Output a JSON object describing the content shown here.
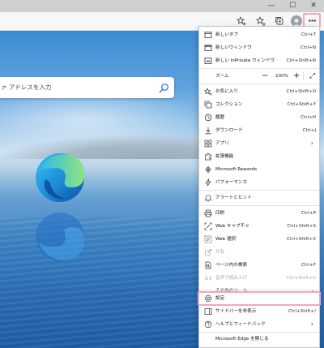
{
  "window": {
    "minimize": "—",
    "maximize": "☐",
    "close": "✕"
  },
  "toolbar": {
    "more": "···"
  },
  "search": {
    "placeholder": "ァ アドレスを入力"
  },
  "menu": {
    "items": [
      {
        "label": "新しいタブ",
        "shortcut": "Ctrl+T",
        "icon": "new-tab-icon"
      },
      {
        "label": "新しいウィンドウ",
        "shortcut": "Ctrl+N",
        "icon": "new-window-icon"
      },
      {
        "label": "新しい InPrivate ウィンドウ",
        "shortcut": "Ctrl+Shift+N",
        "icon": "inprivate-icon"
      },
      {
        "label": "ズーム",
        "icon": "none"
      },
      {
        "label": "お気に入り",
        "shortcut": "Ctrl+Shift+O",
        "icon": "favorites-icon"
      },
      {
        "label": "コレクション",
        "shortcut": "Ctrl+Shift+Y",
        "icon": "collections-icon"
      },
      {
        "label": "履歴",
        "shortcut": "Ctrl+H",
        "icon": "history-icon"
      },
      {
        "label": "ダウンロード",
        "shortcut": "Ctrl+J",
        "icon": "download-icon"
      },
      {
        "label": "アプリ",
        "icon": "apps-icon"
      },
      {
        "label": "拡張機能",
        "icon": "extensions-icon"
      },
      {
        "label": "Microsoft Rewards",
        "icon": "rewards-icon"
      },
      {
        "label": "パフォーマンス",
        "icon": "performance-icon"
      },
      {
        "label": "アラートとヒント",
        "icon": "bell-icon"
      },
      {
        "label": "印刷",
        "shortcut": "Ctrl+P",
        "icon": "print-icon"
      },
      {
        "label": "Web キャプチャ",
        "shortcut": "Ctrl+Shift+S",
        "icon": "web-capture-icon"
      },
      {
        "label": "Web 選択",
        "shortcut": "Ctrl+Shift+X",
        "icon": "web-select-icon"
      },
      {
        "label": "共有",
        "icon": "share-icon"
      },
      {
        "label": "ページ内の検索",
        "shortcut": "Ctrl+F",
        "icon": "find-icon"
      },
      {
        "label": "音声で読み上げ",
        "shortcut": "Ctrl+Shift+U",
        "icon": "read-aloud-icon"
      },
      {
        "label": "その他のツール",
        "icon": "none"
      },
      {
        "label": "設定",
        "icon": "settings-icon"
      },
      {
        "label": "サイドバーを非表示",
        "shortcut": "Ctrl+Shift+/",
        "icon": "sidebar-icon"
      },
      {
        "label": "ヘルプとフィードバック",
        "icon": "help-icon"
      },
      {
        "label": "Microsoft Edge を閉じる",
        "icon": "none"
      }
    ],
    "zoom": {
      "minus": "−",
      "value": "100%",
      "plus": "+",
      "fullscreen": "⤢"
    },
    "arrow": "›"
  }
}
